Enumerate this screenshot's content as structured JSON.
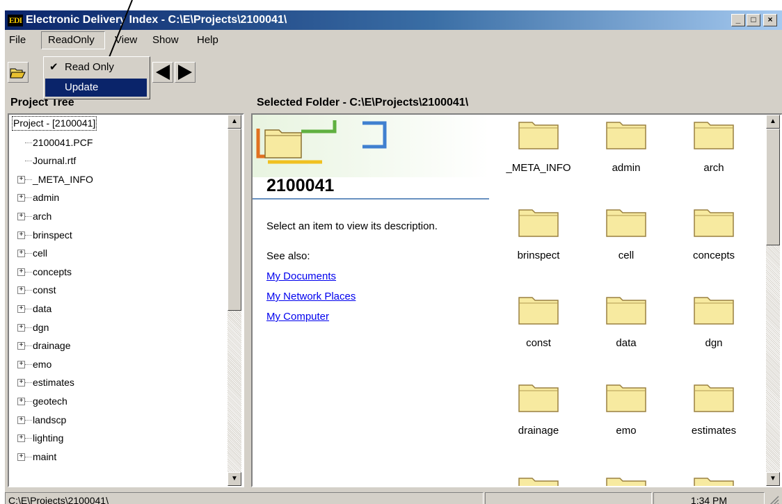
{
  "window": {
    "title": "Electronic Delivery Index - C:\\E\\Projects\\2100041\\",
    "icon_text": "EDI",
    "controls": {
      "minimize": "_",
      "maximize": "□",
      "close": "×"
    }
  },
  "menu": {
    "file": "File",
    "readonly": "ReadOnly",
    "view": "View",
    "show": "Show",
    "help": "Help"
  },
  "dropdown": {
    "items": [
      {
        "check": "✔",
        "label": "Read Only"
      },
      {
        "check": "",
        "label": "Update"
      }
    ]
  },
  "toolbar": {
    "open_icon": "open-folder-icon",
    "back_icon": "left-arrow-icon",
    "forward_icon": "right-arrow-icon"
  },
  "project_tree": {
    "heading": "Project Tree",
    "root": "Project - [2100041]",
    "files": [
      "2100041.PCF",
      "Journal.rtf"
    ],
    "folders": [
      "_META_INFO",
      "admin",
      "arch",
      "brinspect",
      "cell",
      "concepts",
      "const",
      "data",
      "dgn",
      "drainage",
      "emo",
      "estimates",
      "geotech",
      "landscp",
      "lighting",
      "maint"
    ]
  },
  "selected_folder": {
    "heading": "Selected Folder - C:\\E\\Projects\\2100041\\",
    "folder_name": "2100041",
    "description": "Select an item to view its description.",
    "see_also": "See also:",
    "links": [
      "My Documents",
      "My Network Places",
      "My Computer"
    ],
    "items": [
      "_META_INFO",
      "admin",
      "arch",
      "brinspect",
      "cell",
      "concepts",
      "const",
      "data",
      "dgn",
      "drainage",
      "emo",
      "estimates"
    ]
  },
  "status": {
    "path": "C:\\E\\Projects\\2100041\\",
    "time": "1:34 PM"
  },
  "colors": {
    "title_start": "#0a246a",
    "title_end": "#a6caf0",
    "menu_highlight": "#0a246a",
    "folder_fill": "#f7eaa0",
    "link": "#0000ee"
  }
}
